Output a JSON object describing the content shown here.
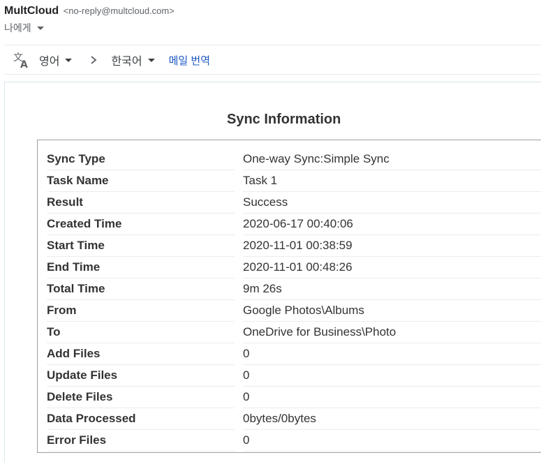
{
  "email": {
    "sender_name": "MultCloud",
    "sender_email": "<no-reply@multcloud.com>",
    "recipient": "나에게"
  },
  "translate": {
    "icon": "translate-icon",
    "source_lang": "영어",
    "target_lang": "한국어",
    "translate_link": "메일 번역"
  },
  "sync": {
    "title": "Sync Information",
    "rows": [
      {
        "label": "Sync Type",
        "value": "One-way Sync:Simple Sync"
      },
      {
        "label": "Task Name",
        "value": "Task 1"
      },
      {
        "label": "Result",
        "value": "Success"
      },
      {
        "label": "Created Time",
        "value": "2020-06-17 00:40:06"
      },
      {
        "label": "Start Time",
        "value": "2020-11-01 00:38:59"
      },
      {
        "label": "End Time",
        "value": "2020-11-01 00:48:26"
      },
      {
        "label": "Total Time",
        "value": "9m 26s"
      },
      {
        "label": "From",
        "value": "Google Photos\\Albums"
      },
      {
        "label": "To",
        "value": "OneDrive for Business\\Photo"
      },
      {
        "label": "Add Files",
        "value": "0"
      },
      {
        "label": "Update Files",
        "value": "0"
      },
      {
        "label": "Delete Files",
        "value": "0"
      },
      {
        "label": "Data Processed",
        "value": "0bytes/0bytes"
      },
      {
        "label": "Error Files",
        "value": "0"
      }
    ]
  }
}
